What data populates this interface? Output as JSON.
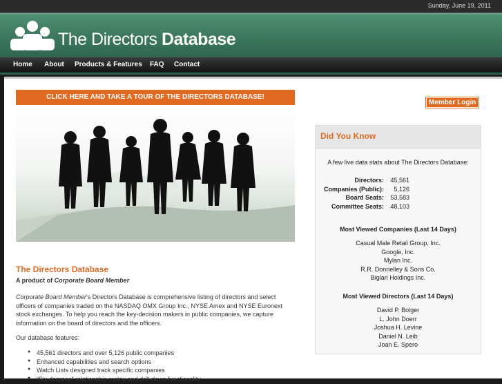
{
  "header": {
    "date": "Sunday, June 19, 2011",
    "logo_thin": "The Directors ",
    "logo_bold": "Database",
    "logo_icon": "people-group-icon"
  },
  "nav": {
    "items": [
      {
        "label": "Home"
      },
      {
        "label": "About"
      },
      {
        "label": "Products & Features"
      },
      {
        "label": "FAQ"
      },
      {
        "label": "Contact"
      }
    ]
  },
  "main": {
    "tour_button": "CLICK HERE AND TAKE A TOUR OF THE DIRECTORS DATABASE!",
    "title": "The Directors Database",
    "subtitle_prefix": "A product of ",
    "subtitle_brand": "Corporate Board Member",
    "paragraph_brand": "Corporate Board Member",
    "paragraph_rest": "'s Directors Database is comprehensive listing of directors and select officers of companies traded on the NASDAQ OMX Group Inc., NYSE Amex and NYSE Euronext stock exchanges. To help you reach the key-decision makers in public companies, we capture information on the board of directors and the officers.",
    "features_heading": "Our database features:",
    "features": [
      "45,561 directors and over 5,126 public companies",
      "Enhanced capabilities and search options",
      "Watch Lists designed track specific companies",
      "“Six degrees” relationship matrix and drill-down functionality"
    ]
  },
  "sidebar": {
    "member_login": "Member Login",
    "did_you_know": {
      "title": "Did You Know",
      "intro": "A few live data stats about The Directors Database:",
      "stats": [
        {
          "label": "Directors:",
          "value": "45,561"
        },
        {
          "label": "Companies (Public):",
          "value": "5,126"
        },
        {
          "label": "Board Seats:",
          "value": "53,583"
        },
        {
          "label": "Committee Seats:",
          "value": "48,103"
        }
      ],
      "companies_title": "Most Viewed Companies (Last 14 Days)",
      "companies": [
        "Casual Male Retail Group, Inc.",
        "Google, Inc.",
        "Mylan Inc.",
        "R.R. Donnelley & Sons Co.",
        "Biglari Holdings Inc."
      ],
      "directors_title": "Most Viewed Directors (Last 14 Days)",
      "directors": [
        "David P. Bolger",
        "L. John Doerr",
        "Joshua H. Levine",
        "Daniel N. Leib",
        "Joan E. Spero"
      ]
    }
  },
  "colors": {
    "accent": "#e06a22",
    "banner_green": "#3d7a60"
  }
}
